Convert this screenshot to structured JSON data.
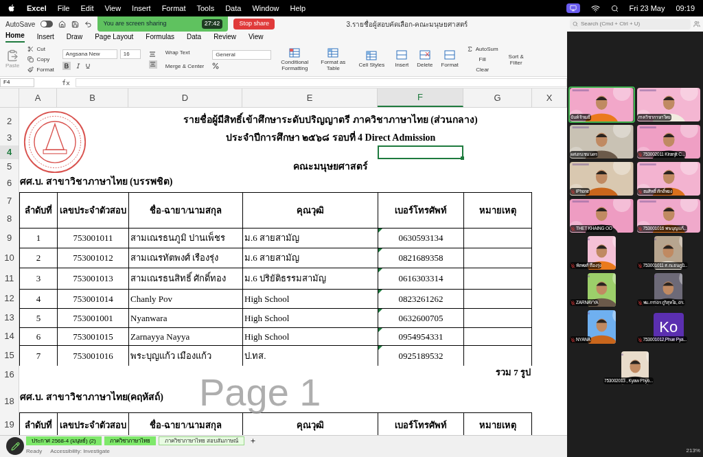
{
  "menu_bar": {
    "app": "Excel",
    "items": [
      "File",
      "Edit",
      "View",
      "Insert",
      "Format",
      "Tools",
      "Data",
      "Window",
      "Help"
    ],
    "date": "Fri 23 May",
    "time": "09:19"
  },
  "toolbar": {
    "autosave": {
      "label": "AutoSave",
      "on": false
    },
    "sharing": {
      "label": "You are screen sharing",
      "timer": "27:42",
      "stop": "Stop share"
    },
    "document_title": "3.รายชื่อผู้สอบคัดเลือก-คณะมนุษยศาสตร์",
    "search": {
      "placeholder": "Search (Cmd + Ctrl + U)"
    }
  },
  "ribbon_tabs": [
    {
      "label": "Home",
      "selected": true
    },
    {
      "label": "Insert",
      "selected": false
    },
    {
      "label": "Draw",
      "selected": false
    },
    {
      "label": "Page Layout",
      "selected": false
    },
    {
      "label": "Formulas",
      "selected": false
    },
    {
      "label": "Data",
      "selected": false
    },
    {
      "label": "Review",
      "selected": false
    },
    {
      "label": "View",
      "selected": false
    }
  ],
  "ribbon": {
    "paste": "Paste",
    "cut": "Cut",
    "copy": "Copy",
    "format_painter": "Format",
    "font": "Angsana New",
    "size": "16",
    "bold": true,
    "align_center": true,
    "wrap_text": "Wrap Text",
    "merge": "Merge & Center",
    "number_format": "General",
    "styles": [
      "Conditional Formatting",
      "Format as Table",
      "Cell Styles"
    ],
    "cells": [
      "Insert",
      "Delete",
      "Format"
    ],
    "autosum": "AutoSum",
    "fill": "Fill",
    "clear": "Clear",
    "sort": "Sort & Filter"
  },
  "formula_bar": {
    "name_box": "F4"
  },
  "columns": [
    {
      "label": "A",
      "selected": false
    },
    {
      "label": "B",
      "selected": false
    },
    {
      "label": "D",
      "selected": false
    },
    {
      "label": "E",
      "selected": false
    },
    {
      "label": "F",
      "selected": true
    },
    {
      "label": "G",
      "selected": false
    },
    {
      "label": "X",
      "selected": false
    }
  ],
  "rows": [
    {
      "kind": "blank"
    },
    {
      "kind": "title",
      "number": "2",
      "selected": false,
      "text": "รายชื่อผู้มีสิทธิ์เข้าศึกษาระดับปริญญาตรี ภาควิชาภาษาไทย (ส่วนกลาง)"
    },
    {
      "kind": "title",
      "number": "3",
      "selected": false,
      "text": "ประจำปีการศึกษา  ๒๕๖๘ รอบที่ 4 Direct Admission"
    },
    {
      "kind": "active",
      "number": "4",
      "selected": true
    },
    {
      "kind": "title",
      "number": "5",
      "selected": false,
      "text": "คณะมนุษยศาสตร์"
    },
    {
      "kind": "section",
      "number": "6",
      "selected": false,
      "text": "ศศ.บ. สาขาวิชาภาษาไทย (บรรพชิต)"
    },
    {
      "kind": "header",
      "numbers": [
        "7",
        "8"
      ],
      "selected": false,
      "cells": [
        "ลำดับที่",
        "เลขประจำตัวสอบ",
        "ชื่อ-ฉายา/นามสกุล",
        "คุณวุฒิ",
        "เบอร์โทรศัพท์",
        "หมายเหตุ"
      ]
    },
    {
      "kind": "data",
      "number": "9",
      "selected": false,
      "cells": [
        "1",
        "753001011",
        "สามเณรธนภูมิ  ปานเพ็ชร",
        "ม.6 สายสามัญ",
        "0630593134"
      ]
    },
    {
      "kind": "data",
      "number": "10",
      "selected": false,
      "cells": [
        "2",
        "753001012",
        "สามเณรทัตพงศ์  เรืองรุ่ง",
        "ม.6 สายสามัญ",
        "0821689358"
      ]
    },
    {
      "kind": "data",
      "number": "11",
      "selected": false,
      "cells": [
        "3",
        "753001013",
        "สามเณรธนสิทธิ์  ศักดิ์ทอง",
        "ม.6 ปริยัติธรรมสามัญ",
        "0616303314"
      ]
    },
    {
      "kind": "data",
      "number": "12",
      "selected": false,
      "cells": [
        "4",
        "753001014",
        "Chanly Pov",
        "High School",
        "0823261262"
      ]
    },
    {
      "kind": "data",
      "number": "13",
      "selected": false,
      "cells": [
        "5",
        "753001001",
        "Nyanwara",
        "High School",
        "0632600705"
      ]
    },
    {
      "kind": "data",
      "number": "14",
      "selected": false,
      "cells": [
        "6",
        "753001015",
        "Zarnayya Nayya",
        "High School",
        "0954954331"
      ]
    },
    {
      "kind": "data",
      "number": "15",
      "selected": false,
      "cells": [
        "7",
        "753001016",
        "พระบุญแก้ว  เมืองแก้ว",
        "ป.ทส.",
        "0925189532"
      ]
    },
    {
      "kind": "total",
      "number": "16",
      "selected": false,
      "total": "รวม 7 รูป"
    },
    {
      "kind": "blank"
    },
    {
      "kind": "section",
      "number": "18",
      "selected": false,
      "text": "ศศ.บ. สาขาวิชาภาษาไทย(คฤหัสถ์)"
    },
    {
      "kind": "header",
      "numbers": [
        "19"
      ],
      "selected": false,
      "cells": [
        "ลำดับที่",
        "เลขประจำตัวสอบ",
        "ชื่อ-ฉายา/นามสกุล",
        "คุณวุฒิ",
        "เบอร์โทรศัพท์",
        "หมายเหตุ"
      ]
    }
  ],
  "page_label": "Page 1",
  "sheet_tabs": [
    {
      "label": "ประกาศ 2568-4 (มนุษย์) (2)",
      "selected": false
    },
    {
      "label": "ภาควิชาภาษาไทย",
      "selected": false
    },
    {
      "label": "ภาควิชาภาษาไทย สอบสัมภาษณ์",
      "selected": true
    }
  ],
  "status_bar": {
    "ready": "Ready",
    "accessibility": "Accessibility: Investigate",
    "zoom": "213%"
  },
  "meeting": {
    "participants": [
      {
        "name": "ฉันท์ จิรเมธี",
        "kind": "video",
        "muted": false,
        "active": true
      },
      {
        "name": "ภาควิชาภาษาไทย",
        "kind": "video",
        "muted": false,
        "active": false
      },
      {
        "name": "ผศ.ดร.เชน นคร",
        "kind": "video",
        "muted": false,
        "active": false
      },
      {
        "name": "753002011 Kiranjit C...",
        "kind": "video",
        "muted": true,
        "active": false
      },
      {
        "name": "iPhone",
        "kind": "video",
        "muted": true,
        "active": false
      },
      {
        "name": "ธนสิทธิ์ ศักดิ์ทอง",
        "kind": "video",
        "muted": true,
        "active": false
      },
      {
        "name": "THET KHAING OO",
        "kind": "video",
        "muted": true,
        "active": false
      },
      {
        "name": "753001016 พระบุญแก้...",
        "kind": "video",
        "muted": true,
        "active": false
      },
      {
        "name": "ทัตพงศ์ เรืองรุ่ง",
        "kind": "video",
        "muted": true,
        "active": false
      },
      {
        "name": "753001011 ส.ณ.ธนภูมิ...",
        "kind": "video",
        "muted": true,
        "active": false
      },
      {
        "name": "ZARNAYYA",
        "kind": "video",
        "muted": true,
        "active": false
      },
      {
        "name": "พม.ภราดร ภูริสุทโธ, ดร.",
        "kind": "video",
        "muted": true,
        "active": false
      },
      {
        "name": "NYANA",
        "kind": "video",
        "muted": true,
        "active": false
      },
      {
        "name": "753001012,Phue Pya...",
        "kind": "avatar",
        "initials": "Ko",
        "muted": true,
        "active": false
      },
      {
        "name": "753002013 , Kyaw Phyo...",
        "kind": "video",
        "muted": false,
        "active": false
      }
    ]
  }
}
